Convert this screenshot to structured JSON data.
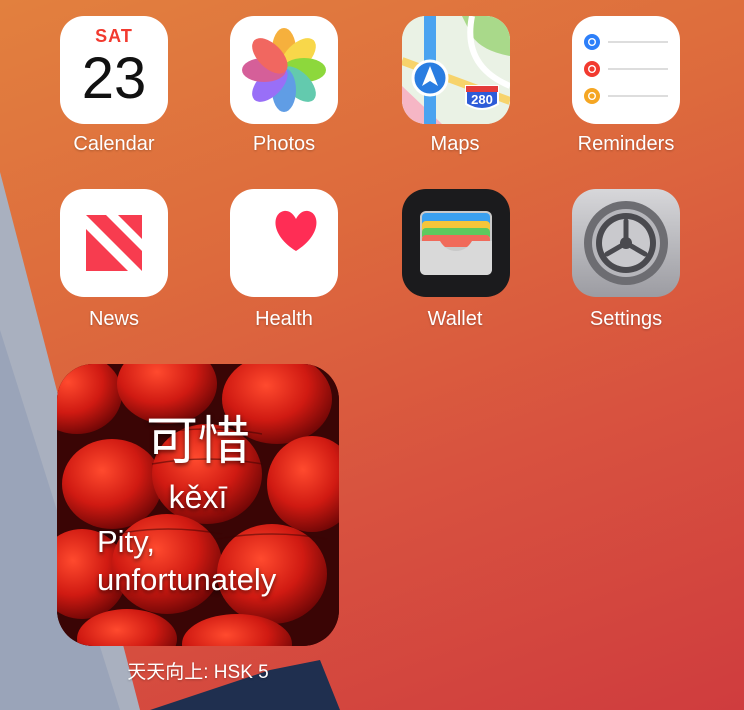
{
  "apps": [
    {
      "id": "calendar",
      "label": "Calendar",
      "day": "SAT",
      "date": "23"
    },
    {
      "id": "photos",
      "label": "Photos"
    },
    {
      "id": "maps",
      "label": "Maps",
      "shield": "280"
    },
    {
      "id": "reminders",
      "label": "Reminders"
    },
    {
      "id": "news",
      "label": "News"
    },
    {
      "id": "health",
      "label": "Health"
    },
    {
      "id": "wallet",
      "label": "Wallet"
    },
    {
      "id": "settings",
      "label": "Settings"
    }
  ],
  "widget": {
    "hanzi": "可惜",
    "pinyin": "kěxī",
    "meaning_line1": "Pity,",
    "meaning_line2": "unfortunately",
    "label": "天天向上: HSK 5"
  },
  "colors": {
    "calendar_red": "#f23a2f",
    "news_red": "#f73c4f",
    "health_pink": "#ff2d55"
  }
}
